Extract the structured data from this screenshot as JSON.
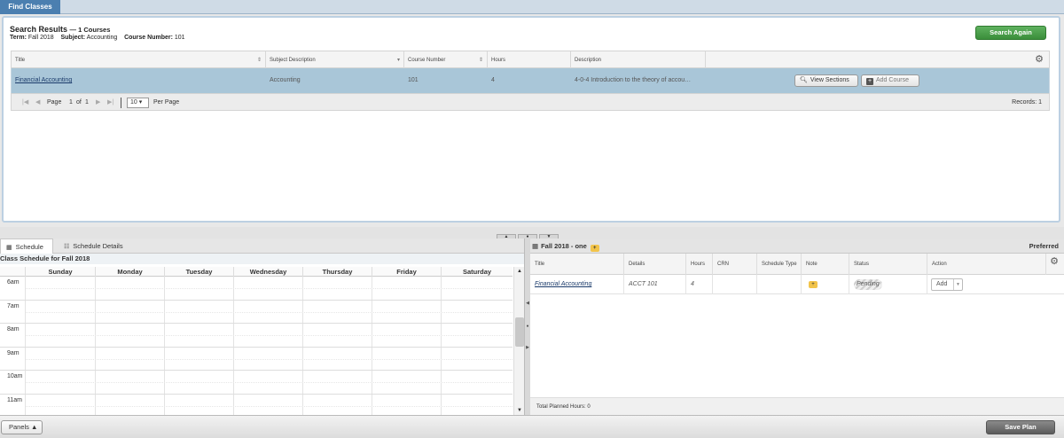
{
  "top_tab": {
    "label": "Find Classes"
  },
  "results": {
    "title": "Search Results",
    "count_text": "— 1 Courses",
    "term_label": "Term:",
    "term_value": "Fall 2018",
    "subject_label": "Subject:",
    "subject_value": "Accounting",
    "course_label": "Course Number:",
    "course_value": "101",
    "search_again_label": "Search Again",
    "columns": [
      "Title",
      "Subject Description",
      "Course Number",
      "Hours",
      "Description"
    ],
    "rows": [
      {
        "title": "Financial Accounting",
        "subject": "Accounting",
        "course_number": "101",
        "hours": "4",
        "description": "4-0-4 Introduction to the theory of accou…",
        "view_sections_label": "View Sections",
        "add_course_label": "Add Course"
      }
    ],
    "pager": {
      "page_label": "Page",
      "page_current": "1",
      "of_label": "of",
      "page_total": "1",
      "per_page_value": "10",
      "per_page_label": "Per Page",
      "records_text": "Records: 1"
    }
  },
  "schedule": {
    "tabs": [
      "Schedule",
      "Schedule Details"
    ],
    "title": "Class Schedule for Fall 2018",
    "days": [
      "Sunday",
      "Monday",
      "Tuesday",
      "Wednesday",
      "Thursday",
      "Friday",
      "Saturday"
    ],
    "hours": [
      "6am",
      "7am",
      "8am",
      "9am",
      "10am",
      "11am"
    ]
  },
  "plan": {
    "title": "Fall 2018 - one",
    "preferred_label": "Preferred",
    "columns": [
      "Title",
      "Details",
      "Hours",
      "CRN",
      "Schedule Type",
      "Note",
      "Status",
      "Action"
    ],
    "rows": [
      {
        "title": "Financial Accounting",
        "details": "ACCT 101",
        "hours": "4",
        "crn": "",
        "schedule_type": "",
        "status": "Pending",
        "action": "Add"
      }
    ],
    "total_hours_text": "Total Planned Hours: 0"
  },
  "bottom": {
    "panels_label": "Panels",
    "save_plan_label": "Save Plan"
  }
}
